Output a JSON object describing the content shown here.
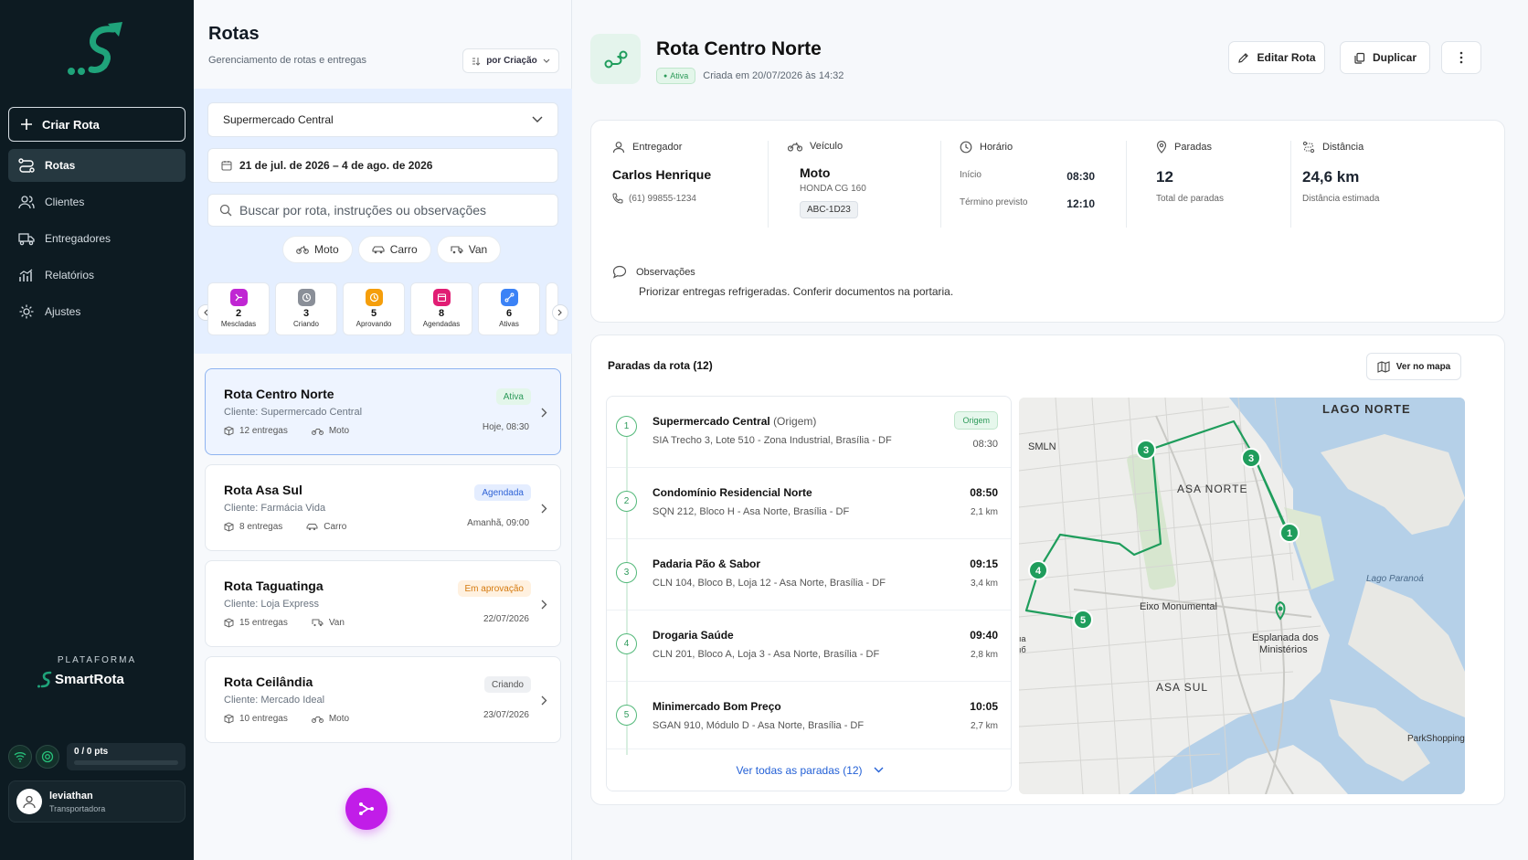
{
  "sidebar": {
    "create_label": "Criar Rota",
    "items": [
      {
        "label": "Rotas",
        "icon": "routes-icon",
        "active": true
      },
      {
        "label": "Clientes",
        "icon": "users-icon",
        "active": false
      },
      {
        "label": "Entregadores",
        "icon": "truck-icon",
        "active": false
      },
      {
        "label": "Relatórios",
        "icon": "chart-icon",
        "active": false
      },
      {
        "label": "Ajustes",
        "icon": "gear-icon",
        "active": false
      }
    ],
    "platform_label": "PLATAFORMA",
    "platform_name": "SmartRota",
    "points": "0 / 0 pts",
    "user": {
      "name": "leviathan",
      "role": "Transportadora"
    },
    "brand_color": "#1fa37a"
  },
  "list_panel": {
    "title": "Rotas",
    "subtitle": "Gerenciamento de rotas e entregas",
    "sort_label": "por Criação",
    "client_select": "Supermercado Central",
    "date_range": "21 de jul. de 2026 – 4 de ago. de 2026",
    "search_placeholder": "Buscar por rota, instruções ou observações",
    "vehicle_chips": [
      "Moto",
      "Carro",
      "Van"
    ],
    "status_cards": [
      {
        "count": "2",
        "label": "Mescladas",
        "color": "#c026d3"
      },
      {
        "count": "3",
        "label": "Criando",
        "color": "#8a8f98"
      },
      {
        "count": "5",
        "label": "Aprovando",
        "color": "#f59e0b"
      },
      {
        "count": "8",
        "label": "Agendadas",
        "color": "#e11d74"
      },
      {
        "count": "6",
        "label": "Ativas",
        "color": "#3b82f6"
      }
    ],
    "routes": [
      {
        "title": "Rota Centro Norte",
        "client": "Cliente: Supermercado Central",
        "deliveries": "12 entregas",
        "vehicle": "Moto",
        "status": "Ativa",
        "date": "Hoje, 08:30"
      },
      {
        "title": "Rota Asa Sul",
        "client": "Cliente: Farmácia Vida",
        "deliveries": "8 entregas",
        "vehicle": "Carro",
        "status": "Agendada",
        "date": "Amanhã, 09:00"
      },
      {
        "title": "Rota Taguatinga",
        "client": "Cliente: Loja Express",
        "deliveries": "15 entregas",
        "vehicle": "Van",
        "status": "Em aprovação",
        "date": "22/07/2026"
      },
      {
        "title": "Rota Ceilândia",
        "client": "Cliente: Mercado Ideal",
        "deliveries": "10 entregas",
        "vehicle": "Moto",
        "status": "Criando",
        "date": "23/07/2026"
      }
    ]
  },
  "detail": {
    "title": "Rota Centro Norte",
    "status": "Ativa",
    "created": "Criada em 20/07/2026 às 14:32",
    "edit_label": "Editar Rota",
    "duplicate_label": "Duplicar",
    "driver": {
      "label": "Entregador",
      "name": "Carlos Henrique",
      "phone": "(61) 99855-1234"
    },
    "vehicle": {
      "label": "Veículo",
      "type": "Moto",
      "model": "HONDA CG 160",
      "plate": "ABC-1D23"
    },
    "schedule": {
      "label": "Horário",
      "start_label": "Início",
      "start": "08:30",
      "end_label": "Término previsto",
      "end": "12:10"
    },
    "stops_info": {
      "label": "Paradas",
      "count": "12",
      "caption": "Total de paradas"
    },
    "distance": {
      "label": "Distância",
      "value": "24,6 km",
      "caption": "Distância estimada"
    },
    "notes": {
      "label": "Observações",
      "text": "Priorizar entregas refrigeradas. Conferir documentos na portaria."
    },
    "stops_title": "Paradas da rota (12)",
    "map_button": "Ver no mapa",
    "see_all": "Ver todas as paradas (12)",
    "stops": [
      {
        "num": "1",
        "name": "Supermercado Central",
        "origin_tag": "(Origem)",
        "addr": "SIA Trecho 3, Lote 510 - Zona Industrial, Brasília - DF",
        "time": "08:30",
        "badge": "Origem"
      },
      {
        "num": "2",
        "name": "Condomínio Residencial Norte",
        "addr": "SQN 212, Bloco H - Asa Norte, Brasília - DF",
        "time": "08:50",
        "dist": "2,1 km"
      },
      {
        "num": "3",
        "name": "Padaria Pão & Sabor",
        "addr": "CLN 104, Bloco B, Loja 12 - Asa Norte, Brasília - DF",
        "time": "09:15",
        "dist": "3,4 km"
      },
      {
        "num": "4",
        "name": "Drogaria Saúde",
        "addr": "CLN 201, Bloco A, Loja 3 - Asa Norte, Brasília - DF",
        "time": "09:40",
        "dist": "2,8 km"
      },
      {
        "num": "5",
        "name": "Minimercado Bom Preço",
        "addr": "SGAN 910, Módulo D - Asa Norte, Brasília - DF",
        "time": "10:05",
        "dist": "2,7 km"
      }
    ],
    "map": {
      "labels": {
        "lago_norte": "LAGO NORTE",
        "smln": "SMLN",
        "asa_norte": "ASA NORTE",
        "lago_paranoa": "Lago Paranoá",
        "eixo": "Eixo Monumental",
        "esplanada": "Esplanada dos",
        "esplanada2": "Ministérios",
        "asa_sul": "ASA SUL",
        "park": "ParkShopping",
        "edge": "ıa",
        "edge2": "ıб"
      },
      "markers": [
        "1",
        "3",
        "3",
        "4",
        "5"
      ],
      "route_color": "#1f9d5c"
    }
  }
}
